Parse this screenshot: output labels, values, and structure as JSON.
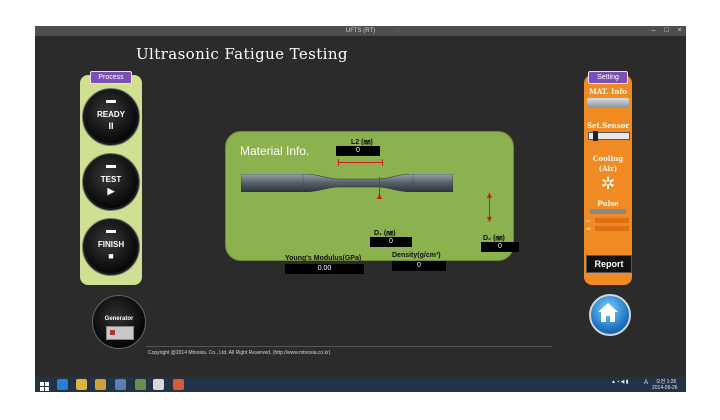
{
  "window": {
    "title": "UFTS (RT)",
    "title_hint": "...",
    "controls": [
      "–",
      "□",
      "×"
    ]
  },
  "app": {
    "title": "Ultrasonic Fatigue Testing"
  },
  "process": {
    "tag": "Process",
    "buttons": [
      {
        "label": "READY",
        "symbol": "II"
      },
      {
        "label": "TEST",
        "symbol": "▶"
      },
      {
        "label": "FINISH",
        "symbol": "■"
      }
    ],
    "generator_label": "Generator"
  },
  "material": {
    "title": "Material Info.",
    "l2_label": "L2 (㎜)",
    "l2_value": "0",
    "d1_label": "D₁ (㎜)",
    "d1_value": "0",
    "d2_label": "D₂ (㎜)",
    "d2_value": "0",
    "youngs_label": "Young's Modulus(GPa)",
    "youngs_value": "0.00",
    "density_label": "Density(g/cm³)",
    "density_value": "0"
  },
  "setting": {
    "tag": "Setting",
    "mat_info": "MAT. Info",
    "set_sensor": "Set.Sensor",
    "cooling": "Cooling",
    "cooling_sub": "(Air)",
    "pulse": "Pulse",
    "pulse_row1": "on",
    "pulse_row2": "off",
    "report": "Report"
  },
  "footer": {
    "copyright": "Copyright @2014 Mtnosia. Co., Ltd. All Right Reserved. (http://www.mtnosia.co.kr)"
  },
  "taskbar": {
    "time": "오전 1:26",
    "date": "2014-06-26",
    "lang": "A"
  },
  "colors": {
    "process_panel": "#cfe090",
    "material_panel": "#8cb24f",
    "setting_panel": "#f08a22",
    "tag_purple": "#7c4fb7",
    "arrow_red": "#d21c1c"
  }
}
